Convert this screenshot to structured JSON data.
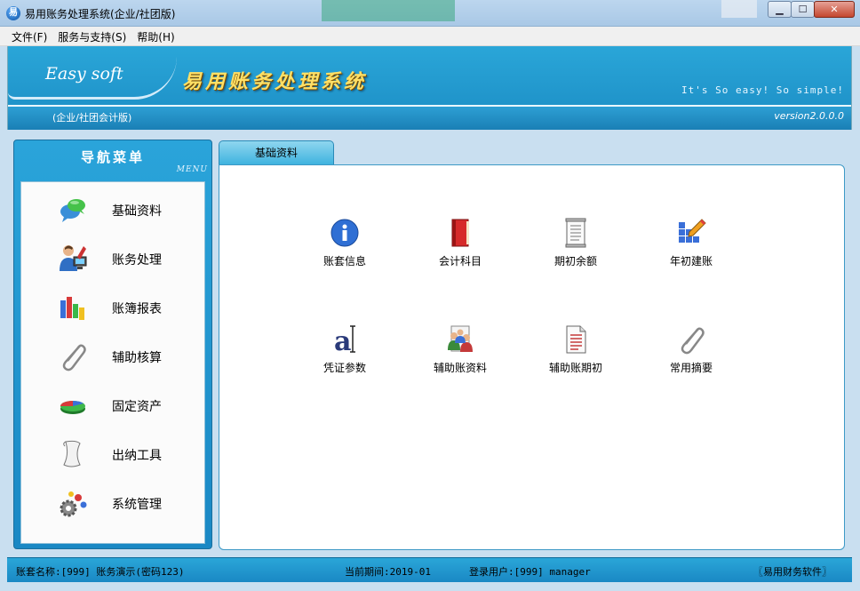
{
  "window": {
    "title": "易用账务处理系统(企业/社团版)",
    "app_icon_char": "易",
    "buttons": {
      "minimize": "▁",
      "maximize": "☐",
      "close": "✕"
    }
  },
  "menu": [
    {
      "label": "文件(F)"
    },
    {
      "label": "服务与支持(S)"
    },
    {
      "label": "帮助(H)"
    }
  ],
  "banner": {
    "logo": "Easy soft",
    "product_name": "易用账务处理系统",
    "slogan": "It's So easy! So simple!",
    "edition": "(企业/社团会计版)",
    "version": "version2.0.0.0"
  },
  "nav": {
    "title": "导航菜单",
    "subtitle": "MENU",
    "items": [
      {
        "label": "基础资料",
        "icon": "chat-bubbles-icon"
      },
      {
        "label": "账务处理",
        "icon": "user-computer-icon"
      },
      {
        "label": "账簿报表",
        "icon": "bar-chart-icon"
      },
      {
        "label": "辅助核算",
        "icon": "paperclip-icon"
      },
      {
        "label": "固定资产",
        "icon": "pie-chart-icon"
      },
      {
        "label": "出纳工具",
        "icon": "scroll-icon"
      },
      {
        "label": "系统管理",
        "icon": "gears-icon"
      }
    ]
  },
  "tab": {
    "label": "基础资料"
  },
  "functions": [
    {
      "label": "账套信息",
      "icon": "info-icon"
    },
    {
      "label": "会计科目",
      "icon": "red-book-icon"
    },
    {
      "label": "期初余额",
      "icon": "document-scroll-icon"
    },
    {
      "label": "年初建账",
      "icon": "blocks-pencil-icon"
    },
    {
      "label": "凭证参数",
      "icon": "text-cursor-icon"
    },
    {
      "label": "辅助账资料",
      "icon": "people-document-icon"
    },
    {
      "label": "辅助账期初",
      "icon": "list-document-icon"
    },
    {
      "label": "常用摘要",
      "icon": "paperclip-icon"
    }
  ],
  "status": {
    "account": "账套名称:[999] 账务演示(密码123)",
    "period": "当前期间:2019-01",
    "user": "登录用户:[999] manager",
    "brand": "〖易用财务软件〗"
  },
  "colors": {
    "accent": "#1b8cc4",
    "product_text": "#ffe066"
  }
}
